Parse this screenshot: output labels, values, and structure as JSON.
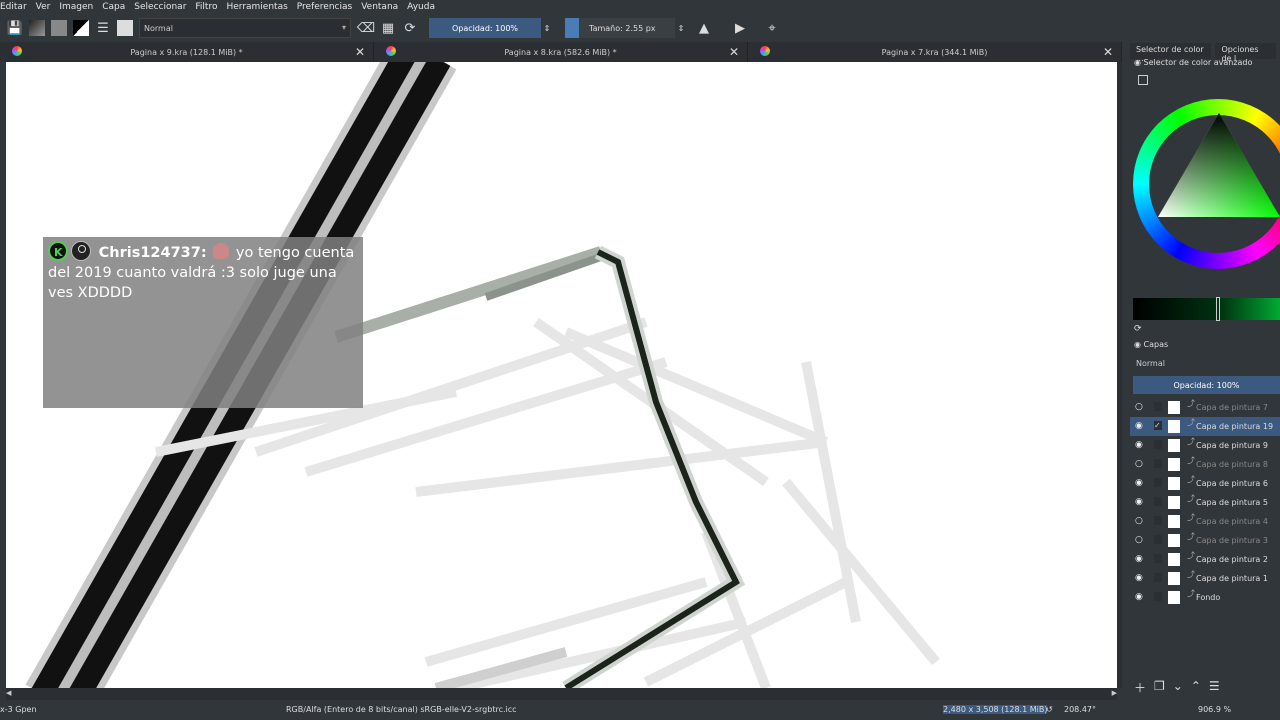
{
  "menu": [
    "Editar",
    "Ver",
    "Imagen",
    "Capa",
    "Seleccionar",
    "Filtro",
    "Herramientas",
    "Preferencias",
    "Ventana",
    "Ayuda"
  ],
  "toolbar": {
    "blend_mode": "Normal",
    "opacity": "Opacidad: 100%",
    "size": "Tamaño: 2.55 px"
  },
  "tabs": [
    {
      "title": "Pagina x 9.kra (128.1 MiB) *"
    },
    {
      "title": "Pagina x 8.kra (582.6 MiB) *"
    },
    {
      "title": "Pagina x 7.kra (344.1 MiB)"
    }
  ],
  "chat": {
    "username": "Chris124737:",
    "message_line1": "yo tengo cuenta",
    "message_rest": "del 2019 cuanto valdrá :3 solo juge una ves XDDDD"
  },
  "dock": {
    "tab1": "Selector de color ...",
    "tab2": "Opciones de l",
    "color_selector_title": "Selector de color avanzado",
    "layers_title": "Capas",
    "layers_blend": "Normal",
    "layers_opacity": "Opacidad:  100%",
    "layers": [
      {
        "name": "Capa de pintura 7",
        "visible": false,
        "active": false
      },
      {
        "name": "Capa de pintura 19",
        "visible": true,
        "active": true
      },
      {
        "name": "Capa de pintura 9",
        "visible": true,
        "active": false
      },
      {
        "name": "Capa de pintura 8",
        "visible": false,
        "active": false
      },
      {
        "name": "Capa de pintura 6",
        "visible": true,
        "active": false
      },
      {
        "name": "Capa de pintura 5",
        "visible": true,
        "active": false
      },
      {
        "name": "Capa de pintura 4",
        "visible": false,
        "active": false
      },
      {
        "name": "Capa de pintura 3",
        "visible": false,
        "active": false
      },
      {
        "name": "Capa de pintura 2",
        "visible": true,
        "active": false
      },
      {
        "name": "Capa de pintura 1",
        "visible": true,
        "active": false
      },
      {
        "name": "Fondo",
        "visible": true,
        "active": false
      }
    ]
  },
  "status": {
    "left": "x-3 Gpen",
    "color_space": "RGB/Alfa (Entero de 8 bits/canal)  sRGB-elle-V2-srgbtrc.icc",
    "dimensions": "2,480 x 3,508 (128.1 MiB)",
    "rotation": "208.47°",
    "zoom": "906.9 %"
  },
  "colors": {
    "accent": "#3c5a80",
    "panel": "#31363b",
    "selection": "#4a7db5"
  }
}
